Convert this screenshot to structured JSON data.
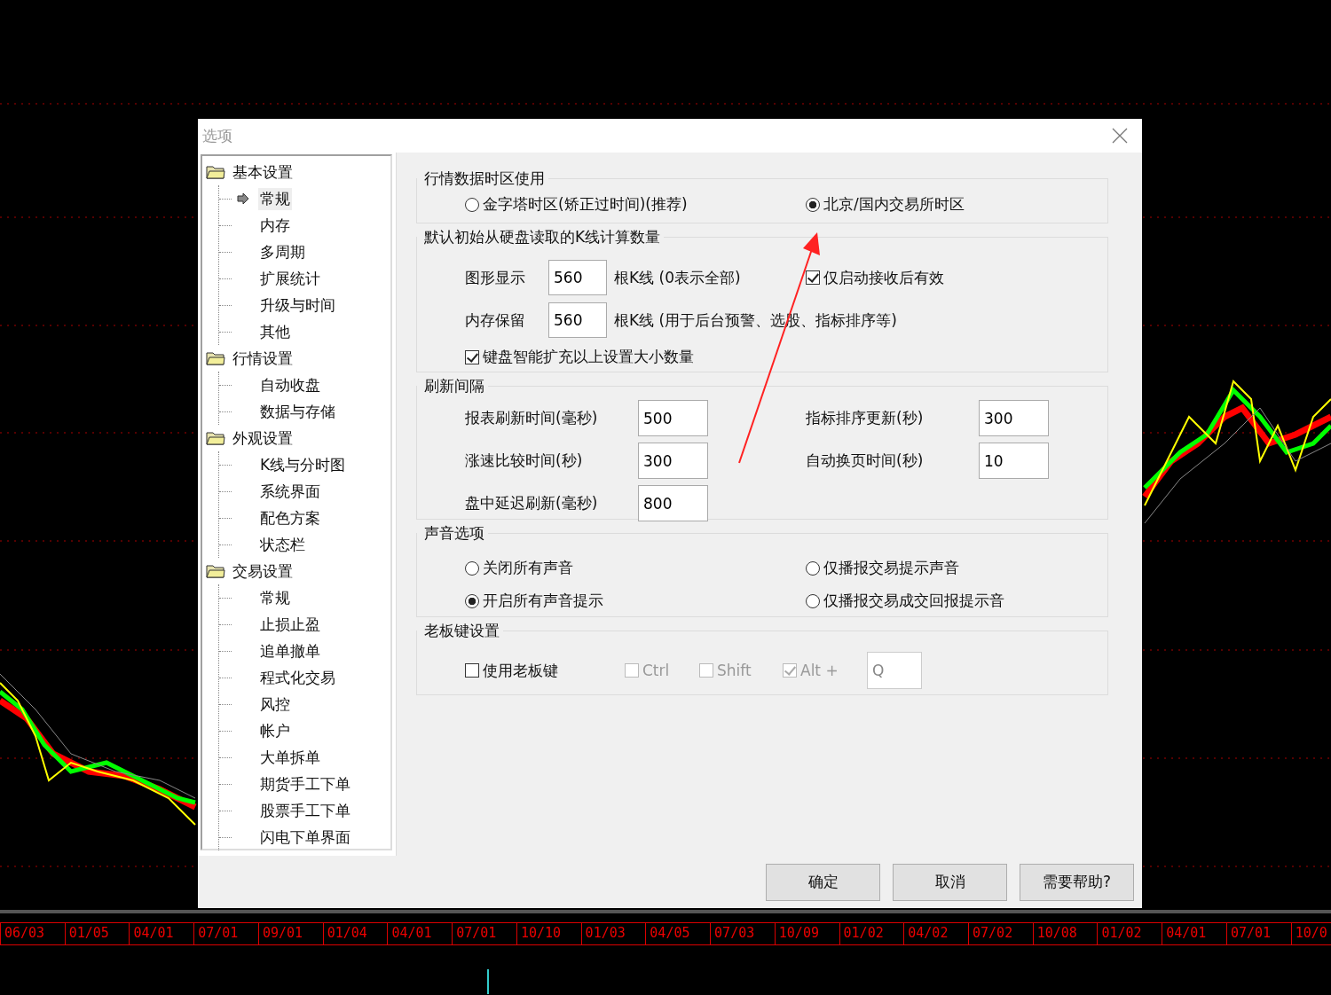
{
  "window": {
    "title": "选项"
  },
  "tree": [
    {
      "label": "基本设置",
      "children": [
        {
          "label": "常规",
          "selected": true
        },
        {
          "label": "内存",
          "selected": false
        },
        {
          "label": "多周期",
          "selected": false
        },
        {
          "label": "扩展统计",
          "selected": false
        },
        {
          "label": "升级与时间",
          "selected": false
        },
        {
          "label": "其他",
          "selected": false
        }
      ]
    },
    {
      "label": "行情设置",
      "children": [
        {
          "label": "自动收盘",
          "selected": false
        },
        {
          "label": "数据与存储",
          "selected": false
        }
      ]
    },
    {
      "label": "外观设置",
      "children": [
        {
          "label": "K线与分时图",
          "selected": false
        },
        {
          "label": "系统界面",
          "selected": false
        },
        {
          "label": "配色方案",
          "selected": false
        },
        {
          "label": "状态栏",
          "selected": false
        }
      ]
    },
    {
      "label": "交易设置",
      "children": [
        {
          "label": "常规",
          "selected": false
        },
        {
          "label": "止损止盈",
          "selected": false
        },
        {
          "label": "追单撤单",
          "selected": false
        },
        {
          "label": "程式化交易",
          "selected": false
        },
        {
          "label": "风控",
          "selected": false
        },
        {
          "label": "帐户",
          "selected": false
        },
        {
          "label": "大单拆单",
          "selected": false
        },
        {
          "label": "期货手工下单",
          "selected": false
        },
        {
          "label": "股票手工下单",
          "selected": false
        },
        {
          "label": "闪电下单界面",
          "selected": false
        }
      ]
    }
  ],
  "timezone": {
    "title": "行情数据时区使用",
    "options": [
      {
        "label": "金字塔时区(矫正过时间)(推荐)",
        "selected": false
      },
      {
        "label": "北京/国内交易所时区",
        "selected": true
      }
    ]
  },
  "kline": {
    "title": "默认初始从硬盘读取的K线计算数量",
    "display": {
      "label": "图形显示",
      "value": "560",
      "unit": "根K线 (0表示全部)"
    },
    "after_start": {
      "label": "仅启动接收后有效",
      "checked": true
    },
    "memory": {
      "label": "内存保留",
      "value": "560",
      "unit": "根K线  (用于后台预警、选股、指标排序等)"
    },
    "keyboard_expand": {
      "label": "键盘智能扩充以上设置大小数量",
      "checked": true
    }
  },
  "refresh": {
    "title": "刷新间隔",
    "fields": [
      {
        "label": "报表刷新时间(毫秒)",
        "value": "500"
      },
      {
        "label": "指标排序更新(秒)",
        "value": "300"
      },
      {
        "label": "涨速比较时间(秒)",
        "value": "300"
      },
      {
        "label": "自动换页时间(秒)",
        "value": "10"
      },
      {
        "label": "盘中延迟刷新(毫秒)",
        "value": "800"
      }
    ]
  },
  "sound": {
    "title": "声音选项",
    "options": [
      {
        "label": "关闭所有声音",
        "selected": false
      },
      {
        "label": "仅播报交易提示声音",
        "selected": false
      },
      {
        "label": "开启所有声音提示",
        "selected": true
      },
      {
        "label": "仅播报交易成交回报提示音",
        "selected": false
      }
    ]
  },
  "boss_key": {
    "title": "老板键设置",
    "checks": [
      {
        "label": "使用老板键",
        "checked": false,
        "disabled": false
      },
      {
        "label": "Ctrl",
        "checked": false,
        "disabled": true
      },
      {
        "label": "Shift",
        "checked": false,
        "disabled": true
      },
      {
        "label": "Alt +",
        "checked": true,
        "disabled": true
      }
    ],
    "key": {
      "value": "Q",
      "disabled": true
    }
  },
  "buttons": [
    "确定",
    "取消",
    "需要帮助?"
  ],
  "axis_dates": [
    "06/03",
    "01/05",
    "04/01",
    "07/01",
    "09/01",
    "01/04",
    "04/01",
    "07/01",
    "10/10",
    "01/03",
    "04/05",
    "07/03",
    "10/09",
    "01/02",
    "04/02",
    "07/02",
    "10/08",
    "01/02",
    "04/01",
    "07/01",
    "10/0"
  ]
}
